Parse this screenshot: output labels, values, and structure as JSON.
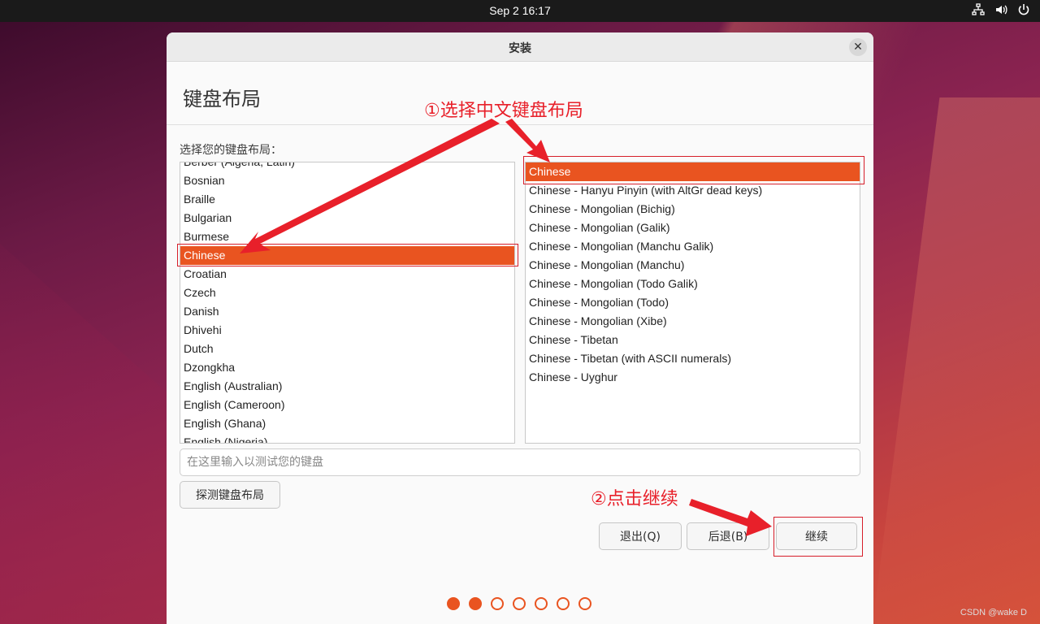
{
  "topbar": {
    "clock": "Sep 2  16:17",
    "tray_icons": [
      "network-icon",
      "volume-icon",
      "power-icon"
    ]
  },
  "window": {
    "title": "安装",
    "heading": "键盘布局",
    "prompt": "选择您的键盘布局：",
    "layouts": [
      "Berber (Algeria, Latin)",
      "Bosnian",
      "Braille",
      "Bulgarian",
      "Burmese",
      "Chinese",
      "Croatian",
      "Czech",
      "Danish",
      "Dhivehi",
      "Dutch",
      "Dzongkha",
      "English (Australian)",
      "English (Cameroon)",
      "English (Ghana)",
      "English (Nigeria)"
    ],
    "selected_layout": "Chinese",
    "variants": [
      "Chinese",
      "Chinese - Hanyu Pinyin (with AltGr dead keys)",
      "Chinese - Mongolian (Bichig)",
      "Chinese - Mongolian (Galik)",
      "Chinese - Mongolian (Manchu Galik)",
      "Chinese - Mongolian (Manchu)",
      "Chinese - Mongolian (Todo Galik)",
      "Chinese - Mongolian (Todo)",
      "Chinese - Mongolian (Xibe)",
      "Chinese - Tibetan",
      "Chinese - Tibetan (with ASCII numerals)",
      "Chinese - Uyghur"
    ],
    "selected_variant": "Chinese",
    "test_placeholder": "在这里输入以测试您的键盘",
    "detect_button": "探测键盘布局",
    "quit_button": "退出(Q)",
    "back_button": "后退(B)",
    "continue_button": "继续",
    "progress": {
      "total": 7,
      "current": 2
    }
  },
  "annotations": {
    "step1": "①选择中文键盘布局",
    "step2": "②点击继续"
  },
  "watermark": "CSDN @wake D",
  "colors": {
    "accent": "#e95420",
    "annotation": "#e8202a"
  }
}
